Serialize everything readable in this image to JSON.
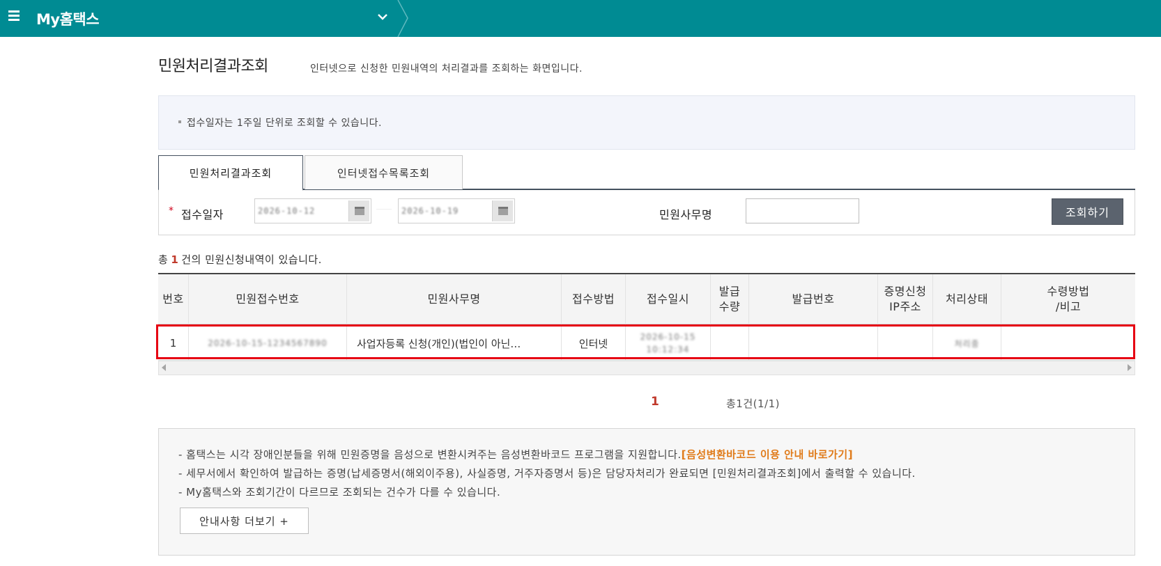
{
  "header": {
    "menu_icon": "hamburger-menu-icon",
    "brand": "My홈택스",
    "dropdown_icon": "chevron-down-icon"
  },
  "page": {
    "title": "민원처리결과조회",
    "description": "인터넷으로 신청한 민원내역의 처리결과를 조회하는 화면입니다."
  },
  "notice": {
    "text": "접수일자는 1주일 단위로 조회할 수 있습니다."
  },
  "tabs": [
    {
      "label": "민원처리결과조회",
      "active": true
    },
    {
      "label": "인터넷접수목록조회",
      "active": false
    }
  ],
  "search": {
    "required_mark": "*",
    "date_label": "접수일자",
    "date_from": "2026-10-12",
    "date_to": "2026-10-19",
    "calendar_icon": "calendar-icon",
    "office_label": "민원사무명",
    "office_value": "",
    "search_button": "조회하기"
  },
  "summary": {
    "prefix": "총",
    "count": "1",
    "suffix": "건의 민원신청내역이 있습니다."
  },
  "table": {
    "columns": [
      "번호",
      "민원접수번호",
      "민원사무명",
      "접수방법",
      "접수일시",
      "발급\n수량",
      "발급번호",
      "증명신청\nIP주소",
      "처리상태",
      "수령방법\n/비고"
    ],
    "rows": [
      {
        "no": "1",
        "receipt_no": "2026-10-15-1234567890",
        "office_name": "사업자등록 신청(개인)(법인이 아닌…",
        "method": "인터넷",
        "datetime_date": "2026-10-15",
        "datetime_time": "10:12:34",
        "issue_qty": "",
        "issue_no": "",
        "ip": "",
        "status": "처리중",
        "remarks": ""
      }
    ]
  },
  "pagination": {
    "current": "1",
    "total": "총1건(1/1)"
  },
  "guide": {
    "line1_text": "- 홈택스는 시각 장애인분들을 위해 민원증명을 음성으로 변환시켜주는 음성변환바코드 프로그램을 지원합니다.",
    "line1_link": "[음성변환바코드 이용 안내 바로가기]",
    "line2": "- 세무서에서 확인하여 발급하는 증명(납세증명서(해외이주용), 사실증명, 거주자증명서 등)은 담당자처리가 완료되면 [민원처리결과조회]에서 출력할 수 있습니다.",
    "line3": "- My홈택스와 조회기간이 다르므로 조회되는 건수가 다를 수 있습니다.",
    "more_button": "안내사항 더보기 +"
  },
  "colors": {
    "header_bg": "#008b93",
    "highlight": "#e60012",
    "link_orange": "#e07b1a",
    "count_red": "#c0392b"
  }
}
